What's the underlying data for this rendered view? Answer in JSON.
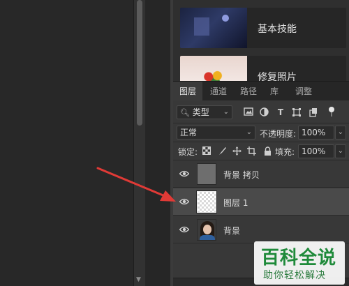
{
  "learn_cards": [
    {
      "label": "基本技能"
    },
    {
      "label": "修复照片"
    }
  ],
  "tabs": [
    {
      "label": "图层",
      "active": true
    },
    {
      "label": "通道",
      "active": false
    },
    {
      "label": "路径",
      "active": false
    },
    {
      "label": "库",
      "active": false
    },
    {
      "label": "调整",
      "active": false
    }
  ],
  "filter": {
    "kind_label": "类型"
  },
  "blend": {
    "mode": "正常",
    "opacity_label": "不透明度:",
    "opacity_value": "100%"
  },
  "lock": {
    "label": "锁定:",
    "fill_label": "填充:",
    "fill_value": "100%"
  },
  "layers": [
    {
      "name": "背景 拷贝",
      "visible": true,
      "selected": false
    },
    {
      "name": "图层 1",
      "visible": true,
      "selected": true
    },
    {
      "name": "背景",
      "visible": true,
      "selected": false
    }
  ],
  "watermark": {
    "title": "百科全说",
    "subtitle": "助你轻松解决"
  },
  "colors": {
    "accent_arrow": "#e03a36",
    "watermark_green": "#1f8a3a"
  }
}
